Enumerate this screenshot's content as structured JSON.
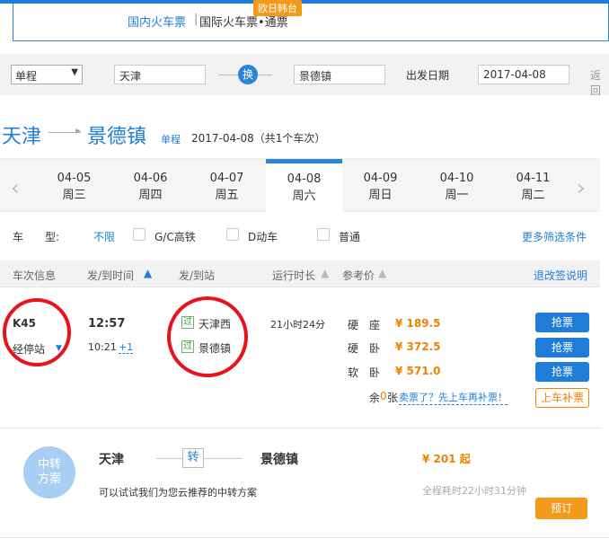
{
  "top": {
    "badge": "欧日韩台",
    "tab_domestic": "国内火车票",
    "sep": "|",
    "tab_international": "国际火车票•通票"
  },
  "search": {
    "trip_type": "单程",
    "from": "天津",
    "swap": "换",
    "to": "景德镇",
    "date_label": "出发日期",
    "date": "2017-04-08",
    "return": "返回"
  },
  "route": {
    "from": "天津",
    "to": "景德镇",
    "trip_type": "单程",
    "summary": "2017-04-08（共1个车次）"
  },
  "dates": [
    {
      "date": "04-05",
      "weekday": "周三"
    },
    {
      "date": "04-06",
      "weekday": "周四"
    },
    {
      "date": "04-07",
      "weekday": "周五"
    },
    {
      "date": "04-08",
      "weekday": "周六"
    },
    {
      "date": "04-09",
      "weekday": "周日"
    },
    {
      "date": "04-10",
      "weekday": "周一"
    },
    {
      "date": "04-11",
      "weekday": "周二"
    }
  ],
  "filter": {
    "label": "车　　型:",
    "unlimited": "不限",
    "gc": "G/C高铁",
    "d": "D动车",
    "normal": "普通",
    "more": "更多筛选条件"
  },
  "columns": {
    "train": "车次信息",
    "time": "发/到时间",
    "station": "发/到站",
    "duration": "运行时长",
    "price": "参考价",
    "refund": "退改签说明"
  },
  "train": {
    "number": "K45",
    "stops": "经停站",
    "dep_time": "12:57",
    "arr_time": "10:21",
    "plus_day": "+1",
    "via_tag": "过",
    "dep_station": "天津西",
    "arr_station": "景德镇",
    "duration": "21小时24分",
    "seats": [
      {
        "name": "硬　座",
        "price": "¥ 189.5",
        "button": "抢票"
      },
      {
        "name": "硬　卧",
        "price": "¥ 372.5",
        "button": "抢票"
      },
      {
        "name": "软　卧",
        "price": "¥ 571.0",
        "button": "抢票"
      }
    ],
    "leftover_prefix": "余",
    "leftover_zero": "0",
    "leftover_unit": "张",
    "sold_out_link": "卖票了？先上车再补票！",
    "onboard_btn": "上车补票"
  },
  "transfer": {
    "logo_line1": "中转",
    "logo_line2": "方案",
    "from": "天津",
    "zhuan": "转",
    "to": "景德镇",
    "tip": "可以试试我们为您云推荐的中转方案",
    "price": "¥ 201 起",
    "total": "全程耗时22小时31分钟",
    "book": "预订"
  },
  "colors": {
    "brand_blue": "#1f7dd7",
    "orange": "#f08200",
    "red_circle": "#e8141c"
  }
}
